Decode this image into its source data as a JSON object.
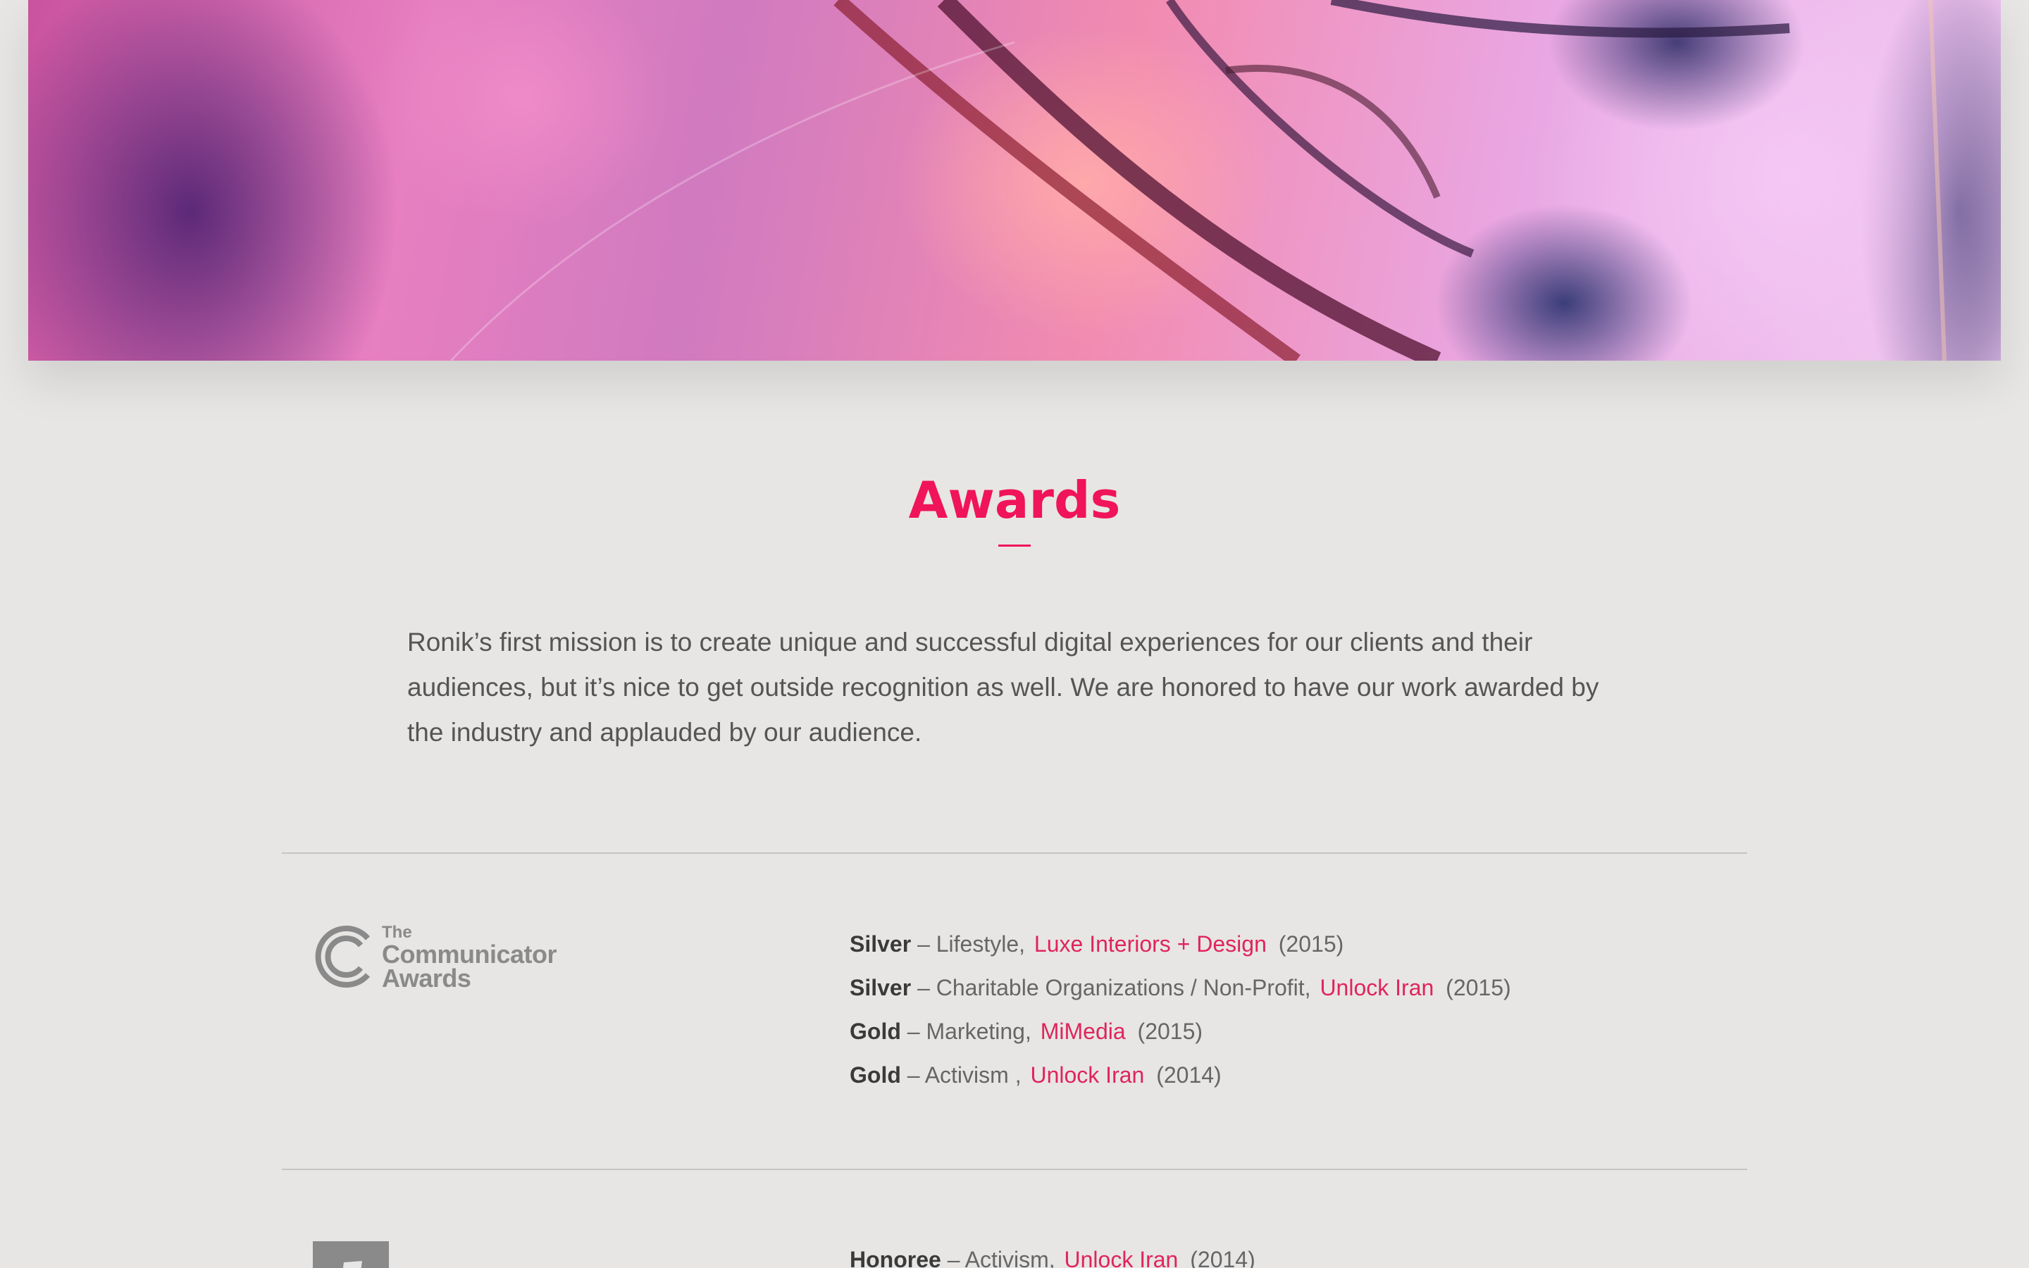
{
  "section": {
    "title": "Awards",
    "intro": "Ronik’s first mission is to create unique and successful digital experiences for our clients and their audiences, but it’s nice to get outside recognition as well. We are honored to have our work awarded by the industry and applauded by our audience."
  },
  "communicator": {
    "logo_line1": "The",
    "logo_line2": "Communicator",
    "logo_line3": "Awards",
    "awards": [
      {
        "level": "Silver",
        "category": "– Lifestyle,",
        "project": "Luxe Interiors + Design",
        "year": "(2015)"
      },
      {
        "level": "Silver",
        "category": "– Charitable Organizations / Non-Profit,",
        "project": "Unlock Iran",
        "year": "(2015)"
      },
      {
        "level": "Gold",
        "category": "– Marketing,",
        "project": "MiMedia",
        "year": "(2015)"
      },
      {
        "level": "Gold",
        "category": "– Activism ,",
        "project": "Unlock Iran",
        "year": "(2014)"
      }
    ]
  },
  "next_group": {
    "awards": [
      {
        "level": "Honoree",
        "category": "– Activism,",
        "project": "Unlock Iran",
        "year": "(2014)"
      }
    ]
  },
  "colors": {
    "accent": "#f0145a",
    "link": "#e0245e",
    "background": "#e7e6e4"
  }
}
